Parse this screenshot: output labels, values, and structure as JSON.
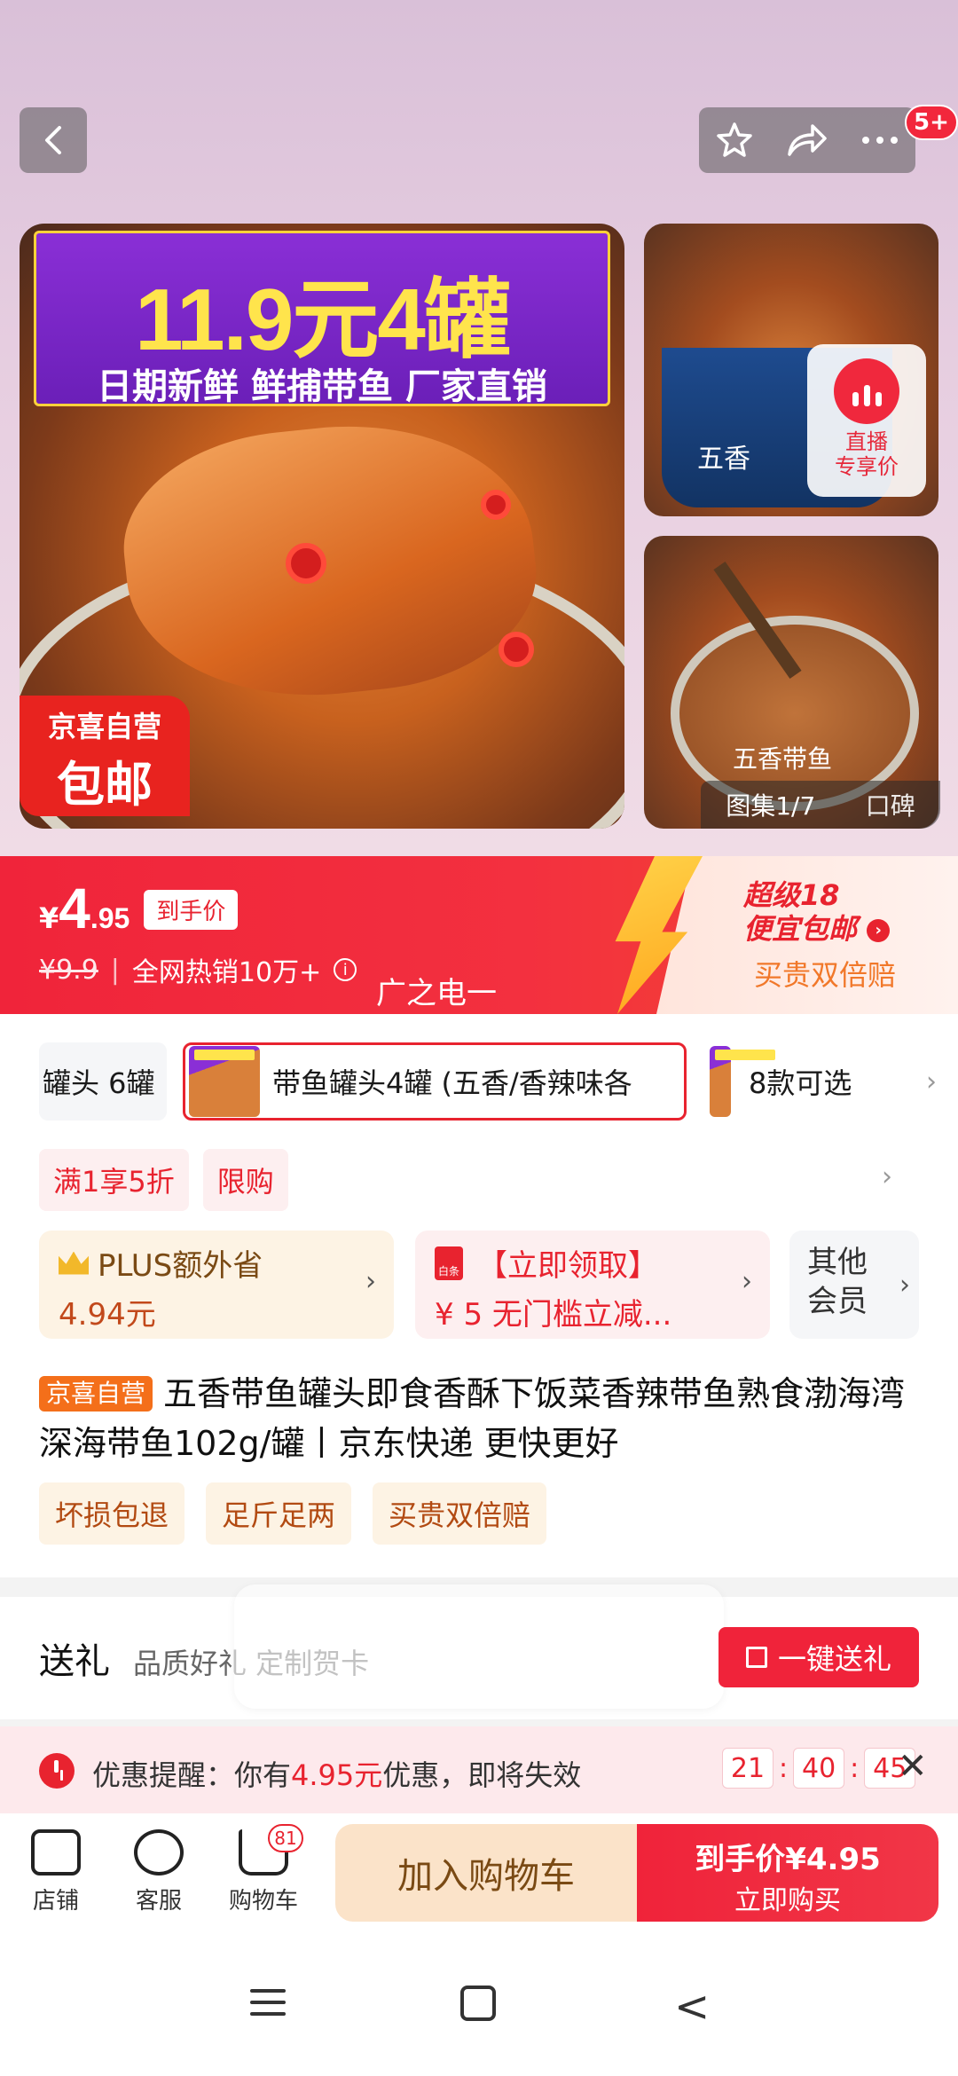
{
  "header": {
    "notification_badge": "5+",
    "icons": [
      "back-icon",
      "star-icon",
      "share-icon",
      "more-icon"
    ]
  },
  "gallery": {
    "promo_headline": "11.9元4罐",
    "promo_subline": "日期新鲜 鲜捕带鱼 厂家直销",
    "badge_line1": "京喜自营",
    "badge_line2": "包邮",
    "side_can_text": "五香",
    "side_can_text2": "五香带鱼",
    "live_label_1": "直播",
    "live_label_2": "专享价",
    "gallery_counter": "图集1/7",
    "reviews_label": "口碑"
  },
  "price": {
    "currency": "¥",
    "integer": "4",
    "decimal": ".95",
    "price_tag": "到手价",
    "original": "¥9.9",
    "sales_info": "全网热销10万+",
    "watermark": "广之电一",
    "super_line1": "超级18",
    "super_line2": "便宜包邮",
    "double_compensation": "买贵双倍赔",
    "colors": {
      "primary_red": "#f0243a",
      "bolt": "#ffc43a"
    }
  },
  "variants": {
    "chip_a": "罐头 6罐",
    "chip_b": "带鱼罐头4罐 (五香/香辣味各",
    "chip_c": "8款可选"
  },
  "coupons": [
    "满1享5折",
    "限购"
  ],
  "benefits": {
    "plus_title": "PLUS额外省",
    "plus_value": "4.94元",
    "coupon_title": "【立即领取】",
    "coupon_desc": "¥ 5 无门槛立减...",
    "baitiao_label": "白条",
    "other_line1": "其他",
    "other_line2": "会员"
  },
  "product": {
    "store_tag": "京喜自营",
    "title": "五香带鱼罐头即食香酥下饭菜香辣带鱼熟食渤海湾深海带鱼102g/罐丨京东快递 更快更好",
    "services": [
      "坏损包退",
      "足斤足两",
      "买贵双倍赔"
    ]
  },
  "gift": {
    "title": "送礼",
    "subtitle": "品质好礼 定制贺卡",
    "button": "一键送礼"
  },
  "reminder": {
    "prefix": "优惠提醒：你有",
    "amount": "4.95元",
    "suffix": "优惠，即将失效",
    "hours": "21",
    "minutes": "40",
    "seconds": "45"
  },
  "action_bar": {
    "store": "店铺",
    "service": "客服",
    "cart": "购物车",
    "cart_count": "81",
    "add_to_cart": "加入购物车",
    "buy_price": "到手价¥4.95",
    "buy_now": "立即购买"
  }
}
